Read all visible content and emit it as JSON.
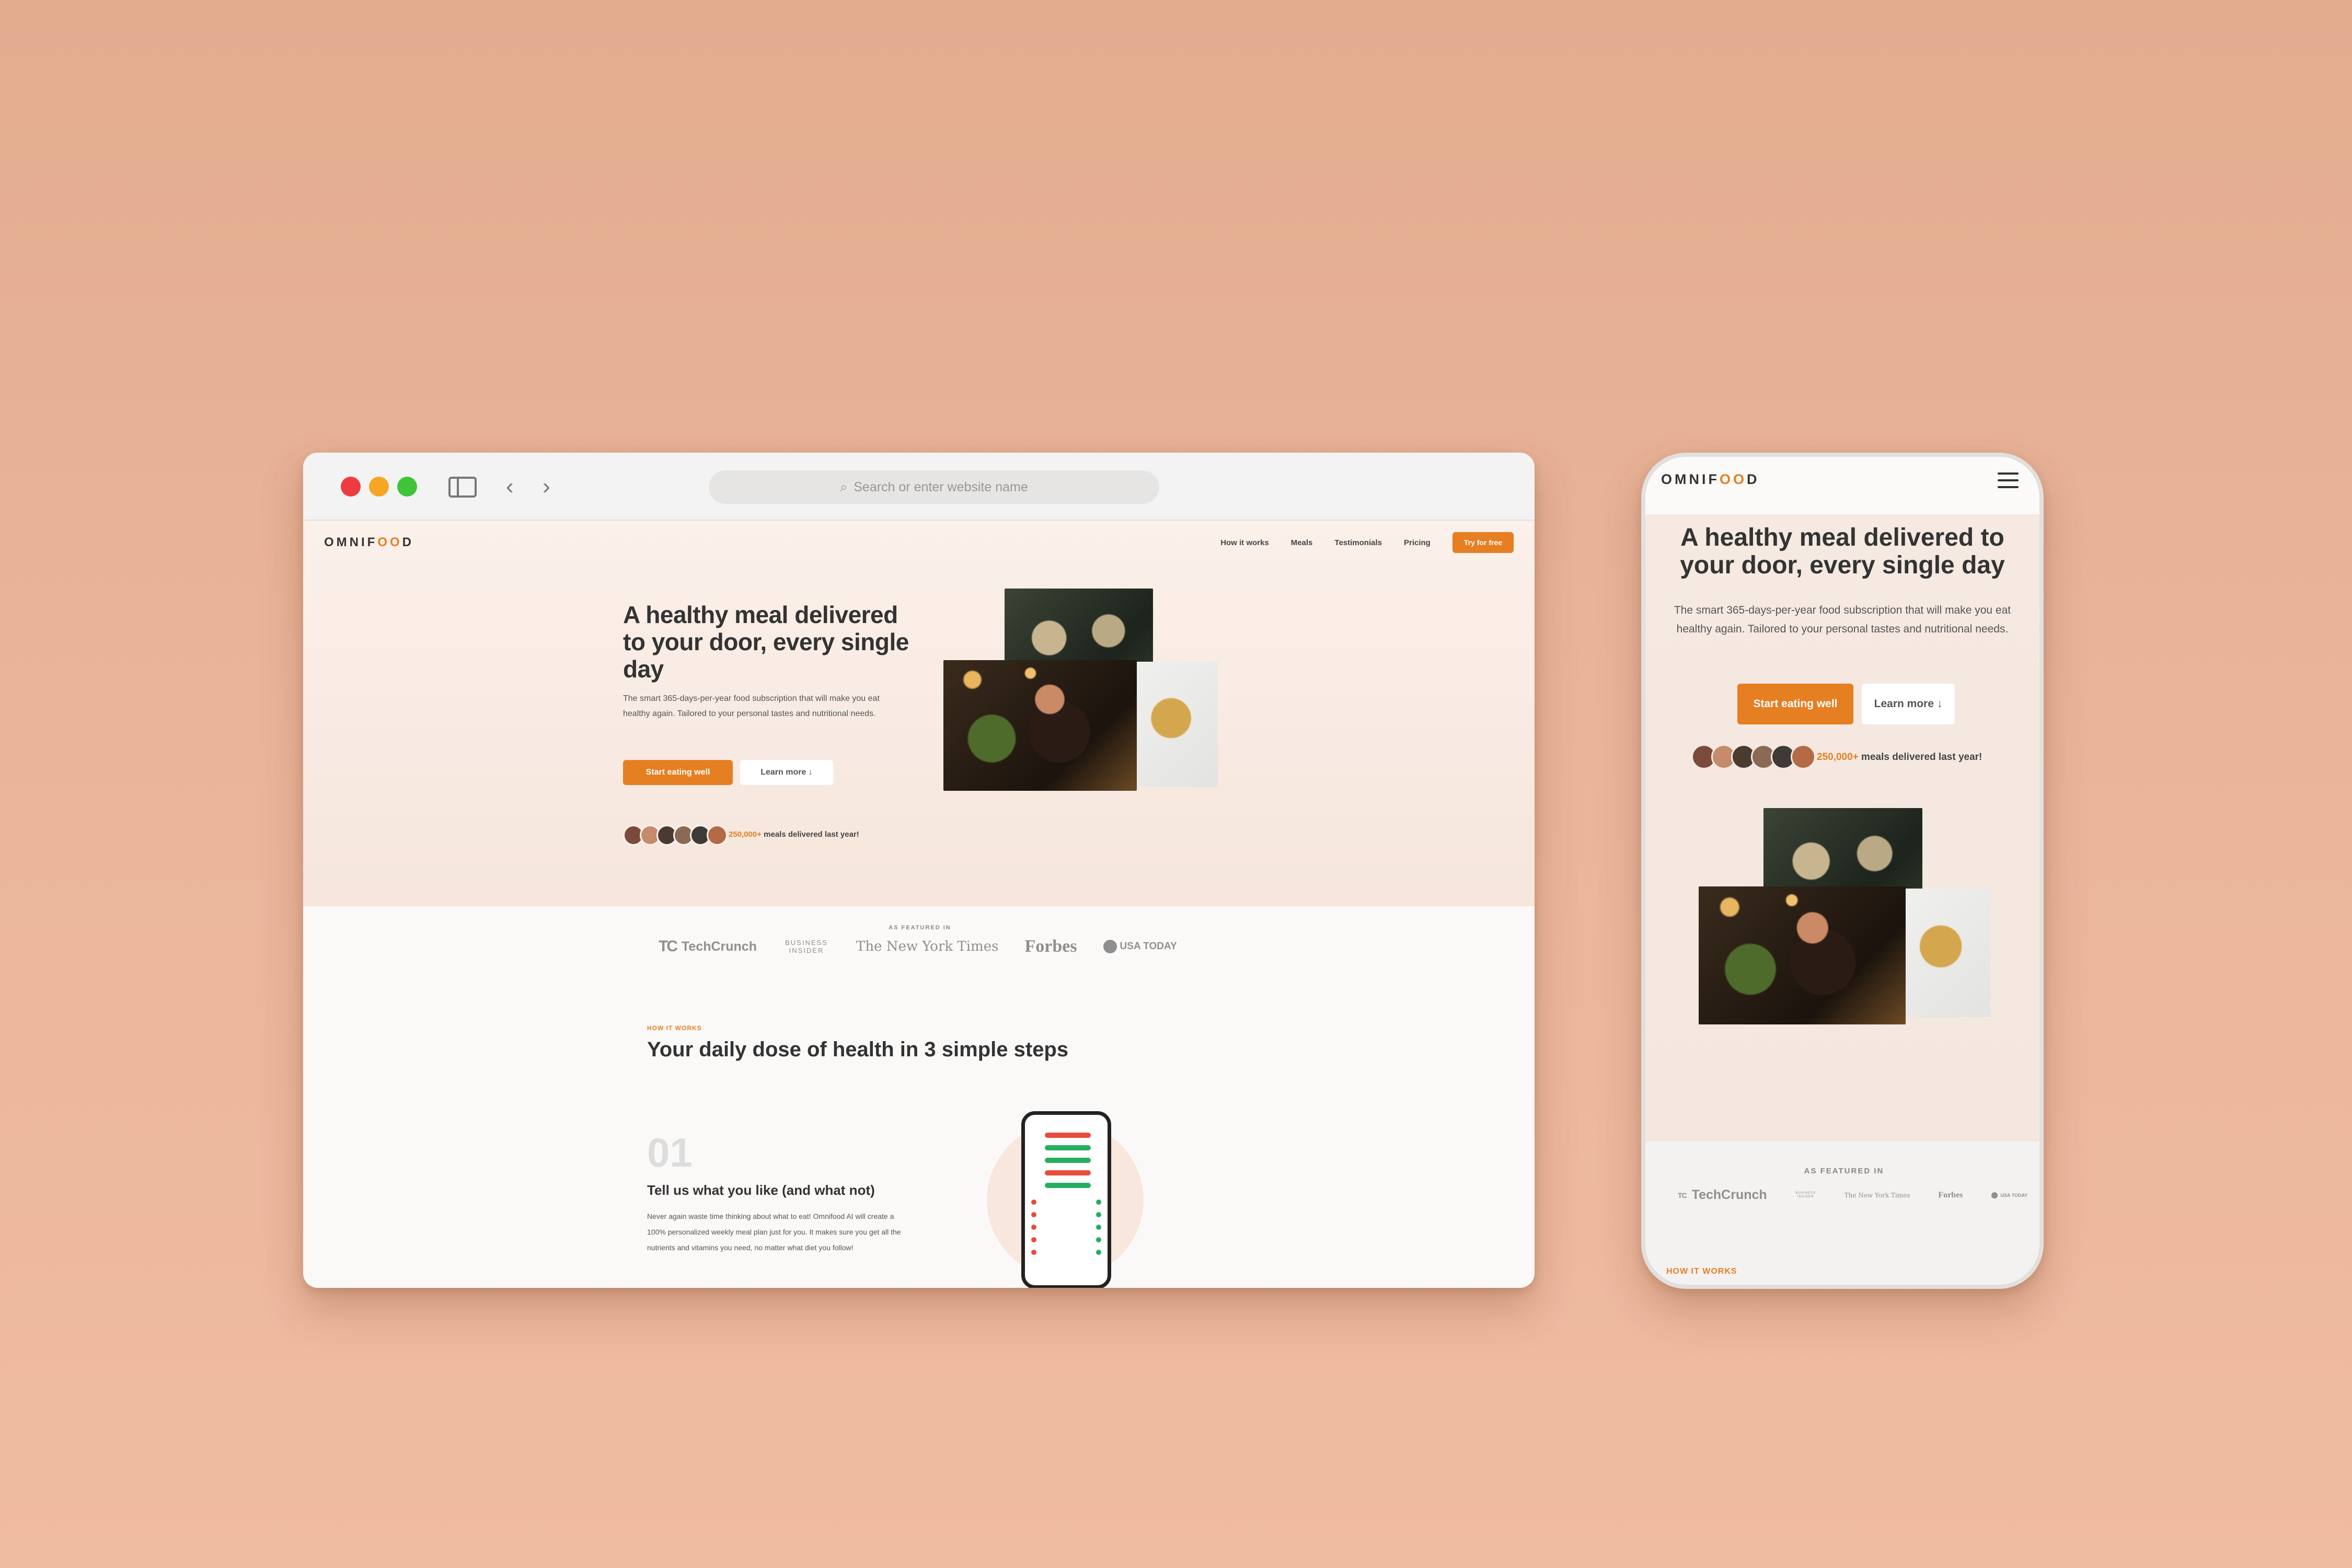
{
  "browser": {
    "address_placeholder": "Search or enter website name"
  },
  "site": {
    "logo_prefix": "OMNIF",
    "logo_oo": "OO",
    "logo_suffix": "D",
    "nav": [
      "How it works",
      "Meals",
      "Testimonials",
      "Pricing"
    ],
    "nav_cta": "Try for free",
    "hero": {
      "title": "A healthy meal delivered to your door, every single day",
      "description": "The smart 365-days-per-year food subscription that will make you eat healthy again. Tailored to your personal tastes and nutritional needs.",
      "primary_button": "Start eating well",
      "secondary_button": "Learn more ↓",
      "meals_count": "250,000+",
      "meals_text": " meals delivered last year!"
    },
    "featured": {
      "label": "AS FEATURED IN",
      "logos": [
        "TechCrunch",
        "BUSINESS INSIDER",
        "The New York Times",
        "Forbes",
        "USA TODAY"
      ],
      "tc_mark": "TC"
    },
    "how_it_works": {
      "label": "HOW IT WORKS",
      "title": "Your daily dose of health in 3 simple steps",
      "step_number": "01",
      "step_title": "Tell us what you like (and what not)",
      "step_description": "Never again waste time thinking about what to eat! Omnifood AI will create a 100% personalized weekly meal plan just for you. It makes sure you get all the nutrients and vitamins you need, no matter what diet you follow!"
    }
  },
  "colors": {
    "accent": "#e67e22",
    "background": "#e9b49a"
  },
  "avatar_colors": [
    "#7a4b3a",
    "#c58b6a",
    "#4a3a30",
    "#8a6a55",
    "#3d3a38",
    "#b36a45"
  ]
}
